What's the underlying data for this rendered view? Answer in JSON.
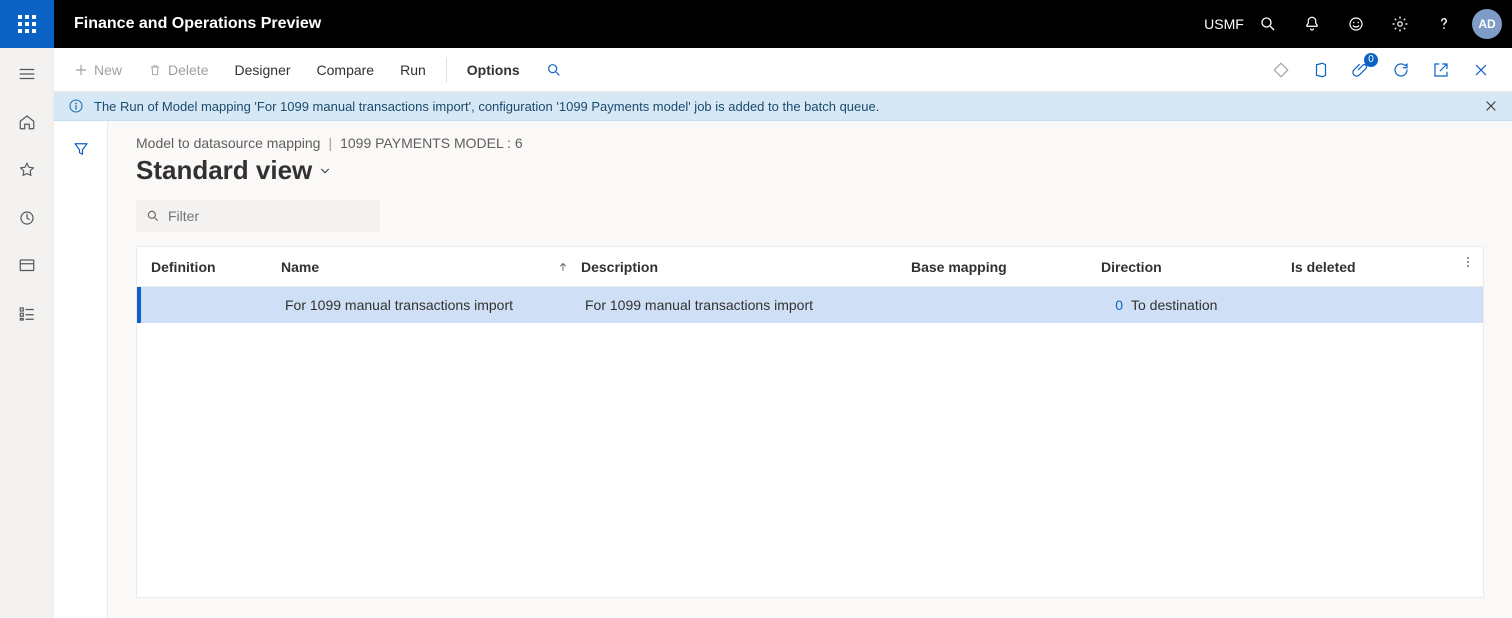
{
  "header": {
    "app_title": "Finance and Operations Preview",
    "company": "USMF",
    "avatar_initials": "AD"
  },
  "actionbar": {
    "new": "New",
    "delete": "Delete",
    "designer": "Designer",
    "compare": "Compare",
    "run": "Run",
    "options": "Options",
    "attachments_badge": "0"
  },
  "banner": {
    "message": "The Run of Model mapping 'For 1099 manual transactions import', configuration '1099 Payments model' job is added to the batch queue."
  },
  "breadcrumb": {
    "page": "Model to datasource mapping",
    "context": "1099 PAYMENTS MODEL : 6"
  },
  "view_name": "Standard view",
  "filter": {
    "placeholder": "Filter"
  },
  "columns": {
    "definition": "Definition",
    "name": "Name",
    "description": "Description",
    "base_mapping": "Base mapping",
    "direction": "Direction",
    "is_deleted": "Is deleted"
  },
  "rows": [
    {
      "definition": "",
      "name": "For 1099 manual transactions import",
      "description": "For 1099 manual transactions import",
      "base_mapping": "",
      "direction_num": "0",
      "direction": "To destination",
      "is_deleted": ""
    }
  ]
}
